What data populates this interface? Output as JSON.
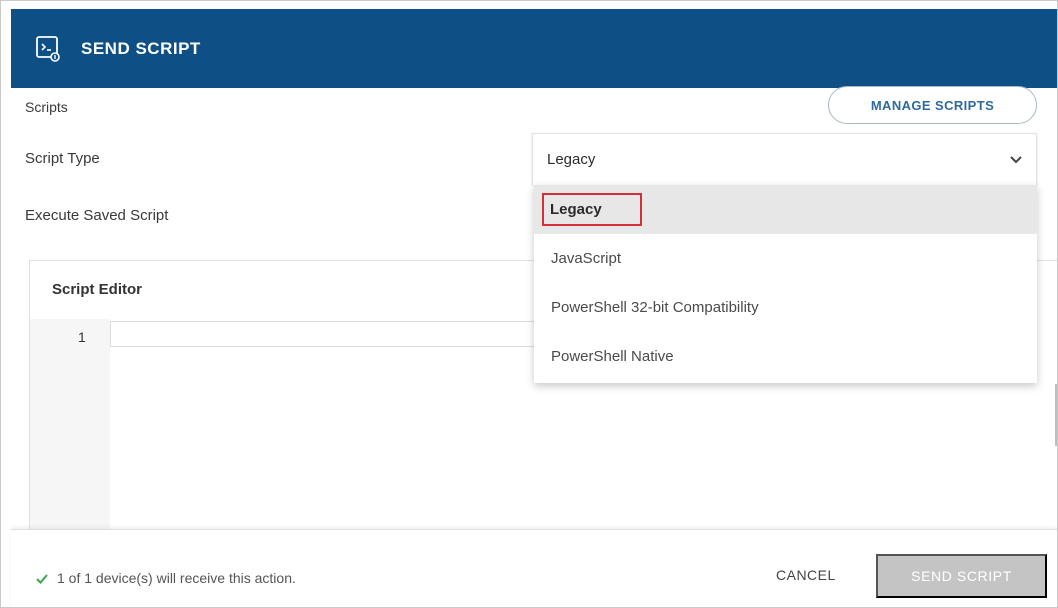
{
  "header": {
    "title": "SEND SCRIPT",
    "icon": "script-terminal-icon",
    "background": "#0e4f86"
  },
  "form": {
    "scripts_label": "Scripts",
    "manage_button": "MANAGE SCRIPTS",
    "script_type_label": "Script Type",
    "script_type_value": "Legacy",
    "execute_label": "Execute Saved Script"
  },
  "dropdown": {
    "options": [
      "Legacy",
      "JavaScript",
      "PowerShell 32-bit Compatibility",
      "PowerShell Native"
    ],
    "selected_index": 0,
    "highlight_color": "#d72f3a"
  },
  "editor": {
    "title": "Script Editor",
    "line_numbers": [
      "1"
    ]
  },
  "footer": {
    "message": "1 of 1 device(s) will receive this action.",
    "cancel": "CANCEL",
    "send": "SEND SCRIPT",
    "check_color": "#3aa651"
  }
}
